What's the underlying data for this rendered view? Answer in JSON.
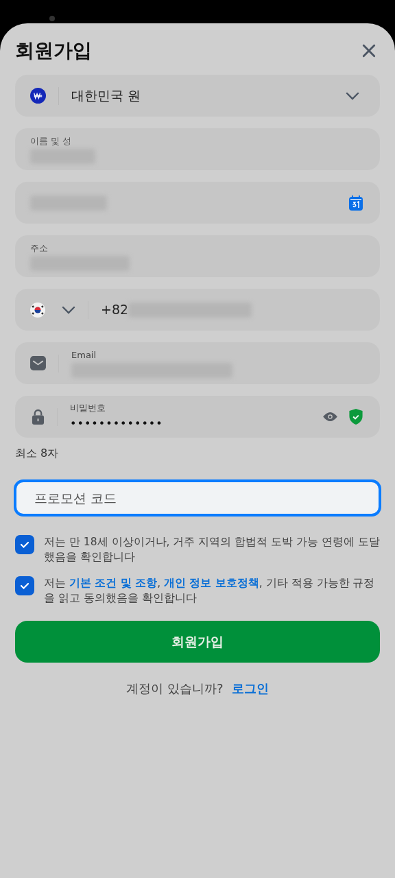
{
  "title": "회원가입",
  "currency": {
    "value": "대한민국 원"
  },
  "fields": [
    {
      "kind": "labeled",
      "label": "이름 및 성",
      "blurred": true
    },
    {
      "kind": "date",
      "blurred": true
    },
    {
      "kind": "labeled",
      "label": "주소",
      "blurred": true
    },
    {
      "kind": "phone",
      "value": "+82",
      "blurred": true
    },
    {
      "kind": "email",
      "label": "Email",
      "blurred": true
    },
    {
      "kind": "password",
      "label": "비밀번호",
      "value": "•••••••••••••"
    }
  ],
  "password_hint": "최소 8자",
  "promo": {
    "placeholder": "프로모션 코드",
    "focused": true
  },
  "consents": [
    {
      "checked": true,
      "parts": [
        {
          "text": "저는 만 18세 이상이거나, 거주 지역의 합법적 도박 가능 연령에 도달했음을 확인합니다",
          "link": false
        }
      ]
    },
    {
      "checked": true,
      "parts": [
        {
          "text": "저는 ",
          "link": false
        },
        {
          "text": "기본 조건 및 조항",
          "link": true
        },
        {
          "text": ", ",
          "link": false
        },
        {
          "text": "개인 정보 보호정책",
          "link": true
        },
        {
          "text": ", 기타 적용 가능한 규정을 읽고 동의했음을 확인합니다",
          "link": false
        }
      ]
    }
  ],
  "submit": "회원가입",
  "login_prompt": "계정이 있습니까?",
  "login_link": "로그인"
}
